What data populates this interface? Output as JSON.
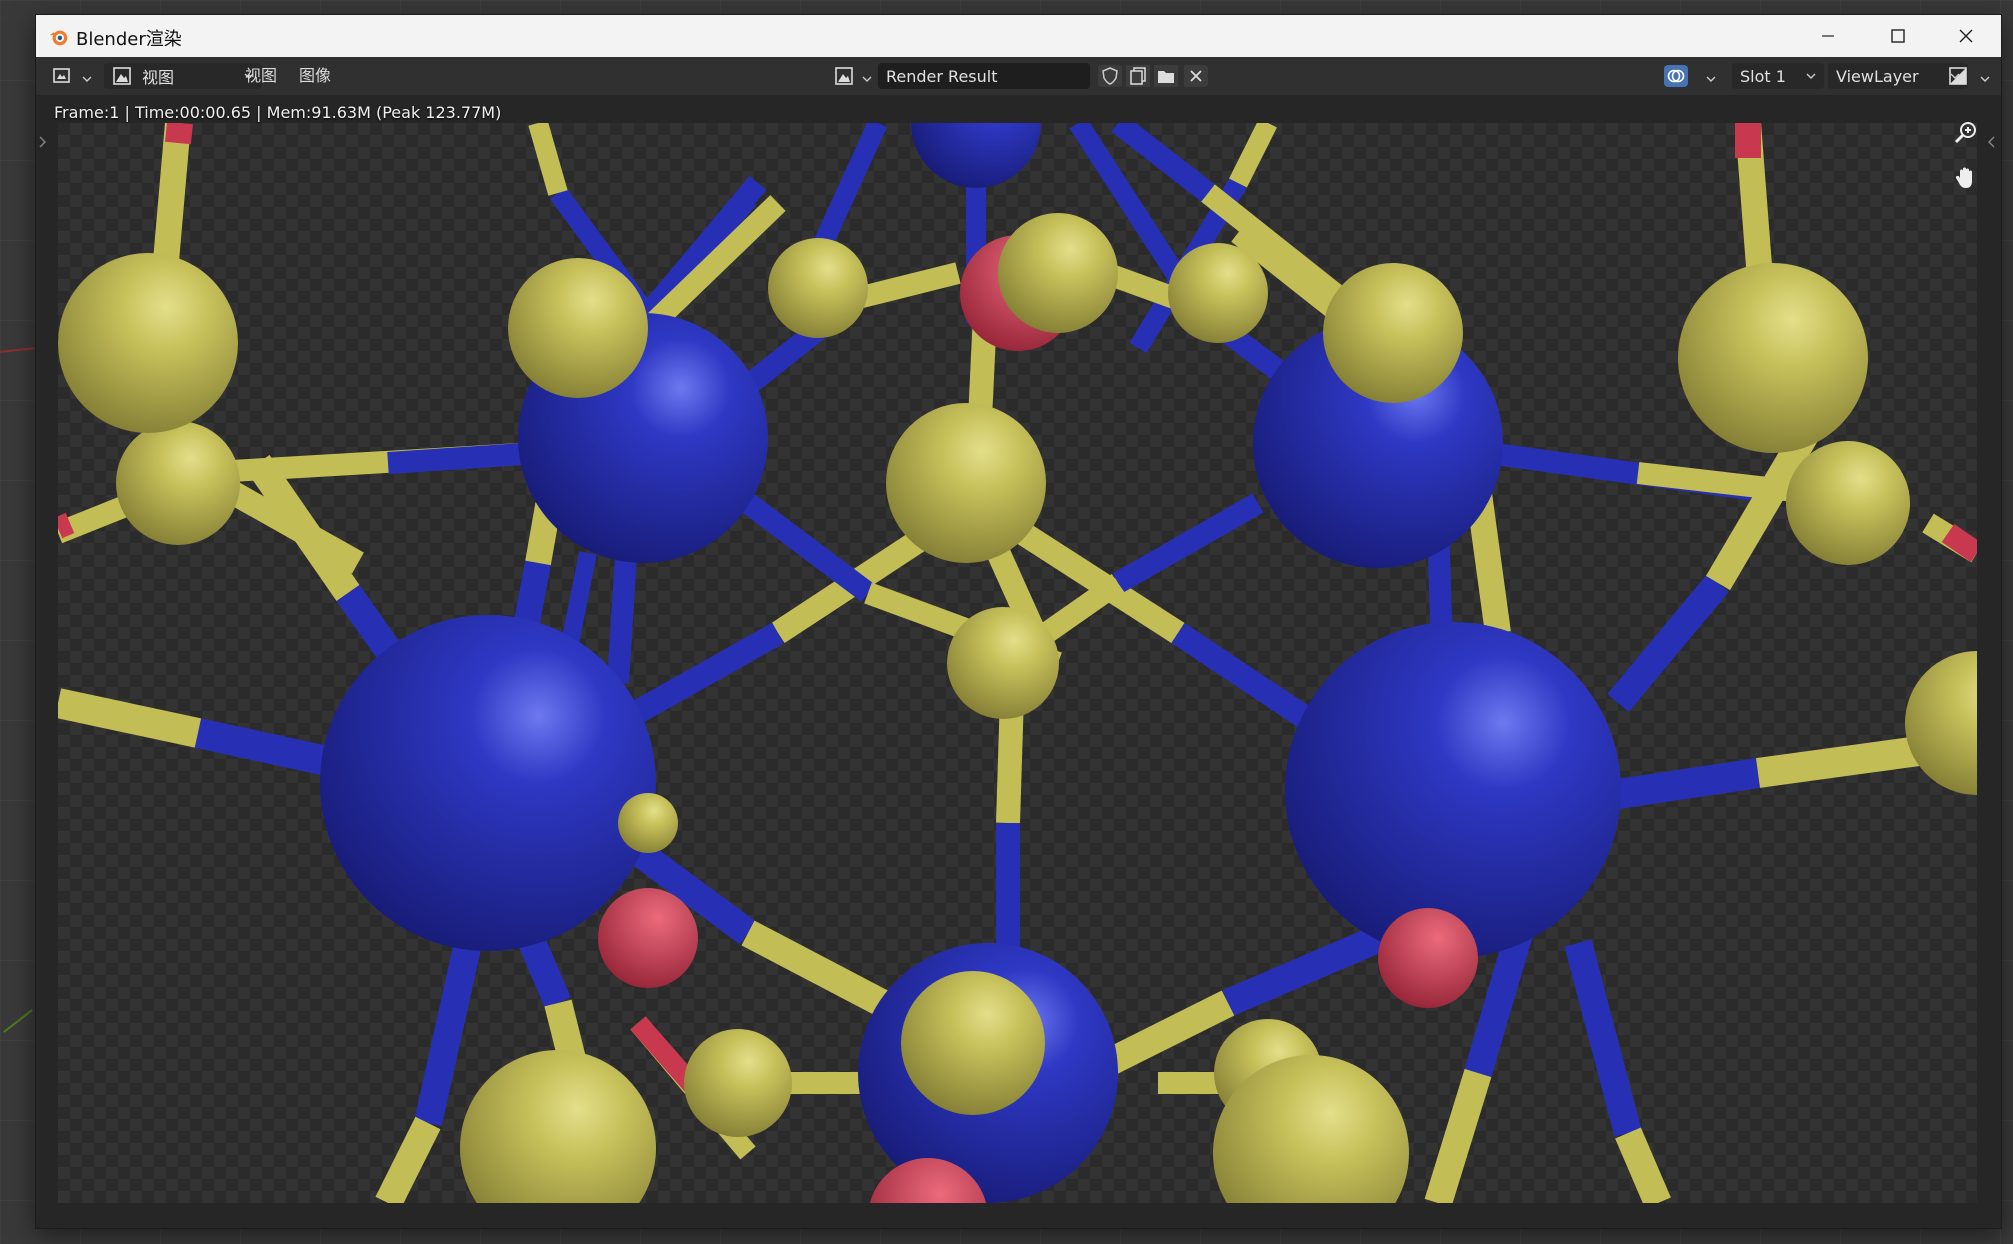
{
  "window": {
    "title": "Blender渲染"
  },
  "header": {
    "view_dropdown": "视图",
    "menu_view": "视图",
    "menu_image": "图像",
    "image_name": "Render Result",
    "slot": "Slot 1",
    "view_layer": "ViewLayer"
  },
  "status": {
    "frame_info": "Frame:1 | Time:00:00.65 | Mem:91.63M (Peak 123.77M)"
  },
  "colors": {
    "atom_blue": "#2a33b8",
    "atom_yellow": "#c6c15a",
    "atom_red": "#c8384e",
    "accent": "#4772b3"
  },
  "icons": [
    "blender-logo-icon",
    "minimize-icon",
    "maximize-icon",
    "close-icon",
    "editor-type-icon",
    "image-icon",
    "shield-icon",
    "duplicate-icon",
    "folder-icon",
    "x-icon",
    "overlay-icon",
    "display-channels-icon",
    "zoom-icon",
    "hand-icon"
  ]
}
